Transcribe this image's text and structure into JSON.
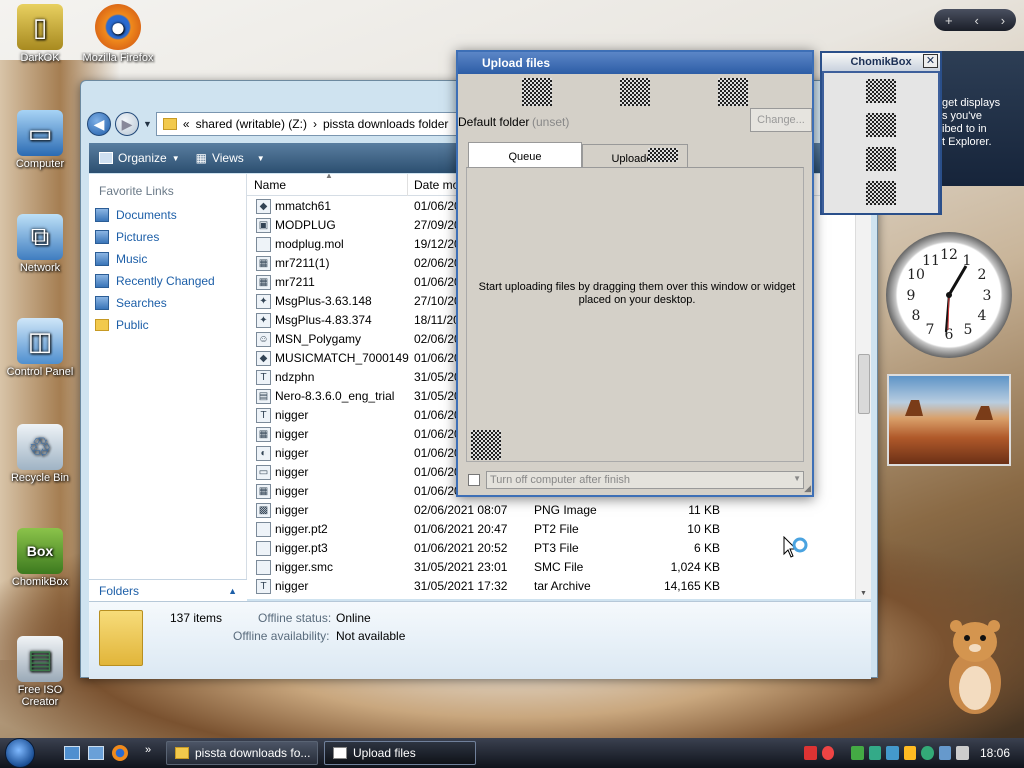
{
  "desktop": {
    "icons": [
      {
        "label": "DarkOK",
        "symbol": "▯"
      },
      {
        "label": "Mozilla Firefox",
        "symbol": "●"
      },
      {
        "label": "Computer",
        "symbol": "▭"
      },
      {
        "label": "Network",
        "symbol": "⧉"
      },
      {
        "label": "Control Panel",
        "symbol": "◫"
      },
      {
        "label": "Recycle Bin",
        "symbol": "♲"
      },
      {
        "label": "ChomikBox",
        "symbol": "Box"
      },
      {
        "label": "Free ISO Creator",
        "symbol": "▤"
      }
    ]
  },
  "explorer": {
    "breadcrumb": {
      "prefix": "«",
      "drive": "shared (writable) (Z:)",
      "sep": "›",
      "folder": "pissta downloads folder"
    },
    "toolbar": {
      "organize": "Organize",
      "views": "Views"
    },
    "sidebar": {
      "heading": "Favorite Links",
      "links": [
        "Documents",
        "Pictures",
        "Music",
        "Recently Changed",
        "Searches",
        "Public"
      ],
      "folders_label": "Folders"
    },
    "columns": {
      "name": "Name",
      "date": "Date mo"
    },
    "rows": [
      {
        "name": "mmatch61",
        "date": "01/06/20",
        "type": "",
        "size": "",
        "icon": "◆"
      },
      {
        "name": "MODPLUG",
        "date": "27/09/20",
        "type": "",
        "size": "",
        "icon": "▣"
      },
      {
        "name": "modplug.mol",
        "date": "19/12/20",
        "type": "",
        "size": "",
        "icon": ""
      },
      {
        "name": "mr7211(1)",
        "date": "02/06/20",
        "type": "",
        "size": "",
        "icon": "▦"
      },
      {
        "name": "mr7211",
        "date": "01/06/20",
        "type": "",
        "size": "",
        "icon": "▦"
      },
      {
        "name": "MsgPlus-3.63.148",
        "date": "27/10/20",
        "type": "",
        "size": "",
        "icon": "✦"
      },
      {
        "name": "MsgPlus-4.83.374",
        "date": "18/11/20",
        "type": "",
        "size": "",
        "icon": "✦"
      },
      {
        "name": "MSN_Polygamy",
        "date": "02/06/20",
        "type": "",
        "size": "",
        "icon": "☺"
      },
      {
        "name": "MUSICMATCH_7000149",
        "date": "01/06/20",
        "type": "",
        "size": "",
        "icon": "◆"
      },
      {
        "name": "ndzphn",
        "date": "31/05/20",
        "type": "",
        "size": "",
        "icon": "T"
      },
      {
        "name": "Nero-8.3.6.0_eng_trial",
        "date": "31/05/20",
        "type": "",
        "size": "",
        "icon": "▤"
      },
      {
        "name": "nigger",
        "date": "01/06/20",
        "type": "",
        "size": "",
        "icon": "T"
      },
      {
        "name": "nigger",
        "date": "01/06/20",
        "type": "",
        "size": "",
        "icon": "▦"
      },
      {
        "name": "nigger",
        "date": "01/06/20",
        "type": "",
        "size": "",
        "icon": "◐"
      },
      {
        "name": "nigger",
        "date": "01/06/20",
        "type": "",
        "size": "",
        "icon": "▭"
      },
      {
        "name": "nigger",
        "date": "01/06/20",
        "type": "",
        "size": "",
        "icon": "▦"
      },
      {
        "name": "nigger",
        "date": "02/06/2021 08:07",
        "type": "PNG Image",
        "size": "11 KB",
        "icon": "▩"
      },
      {
        "name": "nigger.pt2",
        "date": "01/06/2021 20:47",
        "type": "PT2 File",
        "size": "10 KB",
        "icon": ""
      },
      {
        "name": "nigger.pt3",
        "date": "01/06/2021 20:52",
        "type": "PT3 File",
        "size": "6 KB",
        "icon": ""
      },
      {
        "name": "nigger.smc",
        "date": "31/05/2021 23:01",
        "type": "SMC File",
        "size": "1,024 KB",
        "icon": ""
      },
      {
        "name": "nigger",
        "date": "31/05/2021 17:32",
        "type": "tar Archive",
        "size": "14,165 KB",
        "icon": "T"
      }
    ],
    "details": {
      "count": "137 items",
      "offline_status_label": "Offline status:",
      "offline_status_value": "Online",
      "offline_avail_label": "Offline availability:",
      "offline_avail_value": "Not available"
    }
  },
  "upload": {
    "title": "Upload files",
    "default_folder_label": "Default folder",
    "default_folder_value": "(unset)",
    "change_button": "Change...",
    "tabs": [
      "Queue",
      "Uploaded"
    ],
    "message": "Start uploading files by dragging them over this window or widget placed on your desktop.",
    "turn_off_label": "Turn off computer after finish"
  },
  "chomikbox": {
    "title": "ChomikBox",
    "close": "✕"
  },
  "gadget": {
    "lines": [
      "get displays",
      "s you've",
      "ibed to in",
      "t Explorer."
    ]
  },
  "top_tray": {
    "buttons": [
      "+",
      "‹",
      "›"
    ]
  },
  "taskbar": {
    "tasks": [
      {
        "label": "pissta downloads fo...",
        "active": false
      },
      {
        "label": "Upload files",
        "active": true
      }
    ],
    "time": "18:06"
  }
}
